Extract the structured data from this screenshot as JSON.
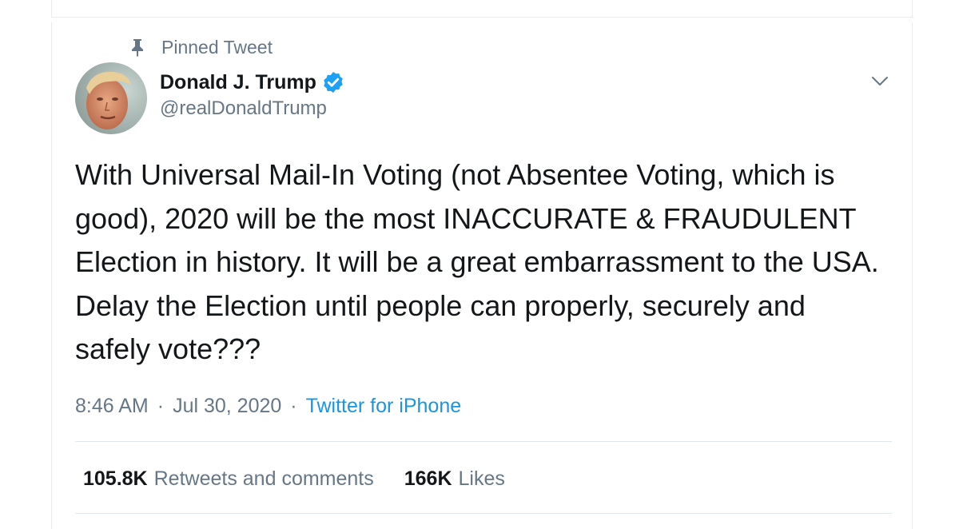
{
  "pinned": {
    "label": "Pinned Tweet",
    "icon": "pin-icon"
  },
  "author": {
    "display_name": "Donald J. Trump",
    "handle": "@realDonaldTrump",
    "verified_color": "#1da1f2"
  },
  "tweet": {
    "text": "With Universal Mail-In Voting (not Absentee Voting, which is good), 2020 will be the most INACCURATE & FRAUDULENT Election in history. It will be a great embarrassment to the USA. Delay the Election until people can properly, securely and safely vote???",
    "time": "8:46 AM",
    "separator": "·",
    "date": "Jul 30, 2020",
    "source": "Twitter for iPhone"
  },
  "stats": {
    "retweets_count": "105.8K",
    "retweets_label": "Retweets and comments",
    "likes_count": "166K",
    "likes_label": "Likes"
  },
  "colors": {
    "text": "#14171a",
    "secondary": "#657786",
    "link": "#1b95e0",
    "border": "#e6ecf0"
  }
}
